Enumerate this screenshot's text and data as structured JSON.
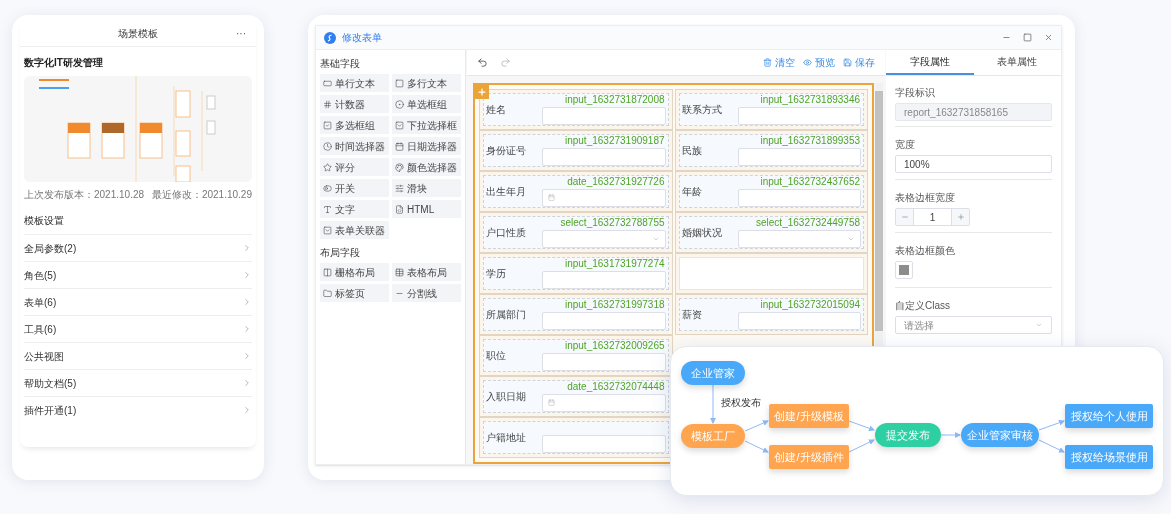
{
  "scene_card": {
    "title": "场景模板",
    "menu": "···",
    "template_name": "数字化IT研发管理",
    "last_published": "上次发布版本：2021.10.28",
    "last_modified": "最近修改：2021.10.29",
    "settings_heading": "模板设置",
    "settings_items": [
      {
        "label": "全局参数(2)"
      },
      {
        "label": "角色(5)"
      },
      {
        "label": "表单(6)"
      },
      {
        "label": "工具(6)"
      },
      {
        "label": "公共视图"
      },
      {
        "label": "帮助文档(5)"
      },
      {
        "label": "插件开通(1)"
      }
    ]
  },
  "editor": {
    "title": "修改表单",
    "palette": [
      {
        "heading": "基础字段",
        "items": [
          "单行文本",
          "多行文本",
          "计数器",
          "单选框组",
          "多选框组",
          "下拉选择框",
          "时间选择器",
          "日期选择器",
          "评分",
          "颜色选择器",
          "开关",
          "滑块",
          "文字",
          "HTML",
          "表单关联器"
        ]
      },
      {
        "heading": "布局字段",
        "items": [
          "栅格布局",
          "表格布局",
          "标签页",
          "分割线"
        ]
      }
    ],
    "toolbar": [
      "清空",
      "预览",
      "保存"
    ],
    "form_rows": [
      {
        "cells": [
          {
            "kind": "input",
            "label": "姓名",
            "field_id": "input_1632731872008"
          },
          {
            "kind": "input",
            "label": "联系方式",
            "field_id": "input_1632731893346"
          }
        ]
      },
      {
        "cells": [
          {
            "kind": "input",
            "label": "身份证号",
            "field_id": "input_1632731909187"
          },
          {
            "kind": "input",
            "label": "民族",
            "field_id": "input_1632731899353"
          }
        ]
      },
      {
        "cells": [
          {
            "kind": "date",
            "label": "出生年月",
            "field_id": "date_1632731927726"
          },
          {
            "kind": "input",
            "label": "年龄",
            "field_id": "input_1632732437652"
          }
        ]
      },
      {
        "cells": [
          {
            "kind": "select",
            "label": "户口性质",
            "field_id": "select_1632732788755"
          },
          {
            "kind": "select",
            "label": "婚姻状况",
            "field_id": "select_1632732449758"
          }
        ]
      },
      {
        "cells": [
          {
            "kind": "input",
            "label": "学历",
            "field_id": "input_1631731977274"
          },
          {
            "kind": "empty"
          }
        ]
      },
      {
        "cells": [
          {
            "kind": "input",
            "label": "所属部门",
            "field_id": "input_1632731997318"
          },
          {
            "kind": "input",
            "label": "薪资",
            "field_id": "input_1632732015094"
          }
        ]
      },
      {
        "cells": [
          {
            "kind": "input",
            "label": "职位",
            "field_id": "input_1632732009265"
          }
        ]
      },
      {
        "cells": [
          {
            "kind": "date",
            "label": "入职日期",
            "field_id": "date_1632732074448"
          }
        ]
      },
      {
        "cells": [
          {
            "kind": "input",
            "label": "户籍地址"
          }
        ]
      }
    ],
    "properties": {
      "tabs": [
        {
          "label": "字段属性",
          "selected": true
        },
        {
          "label": "表单属性",
          "selected": false
        }
      ],
      "field_id_label": "字段标识",
      "field_id_value": "report_1632731858165",
      "width_label": "宽度",
      "width_value": "100%",
      "border_width_label": "表格边框宽度",
      "border_width_value": "1",
      "border_color_label": "表格边框颜色",
      "border_color_swatch": {
        "color": "#8c8c8c"
      },
      "class_label": "自定义Class",
      "class_placeholder": "请选择"
    }
  },
  "flow": {
    "nodes": [
      {
        "label": "企业管家",
        "kind": "pill",
        "color": "#4aa8f8"
      },
      {
        "label": "模板工厂",
        "kind": "pill",
        "color": "#ffa54f"
      },
      {
        "label": "创建/升级模板",
        "kind": "box",
        "color": "#ffa54f"
      },
      {
        "label": "创建/升级插件",
        "kind": "box",
        "color": "#ffa54f"
      },
      {
        "label": "提交发布",
        "kind": "pill",
        "color": "#2fcfa4"
      },
      {
        "label": "企业管家审核",
        "kind": "pill",
        "color": "#4aa8f8"
      },
      {
        "label": "授权给个人使用",
        "kind": "box",
        "color": "#4aa8f8"
      },
      {
        "label": "授权给场景使用",
        "kind": "box",
        "color": "#4aa8f8"
      }
    ],
    "edge_label": "授权发布"
  }
}
